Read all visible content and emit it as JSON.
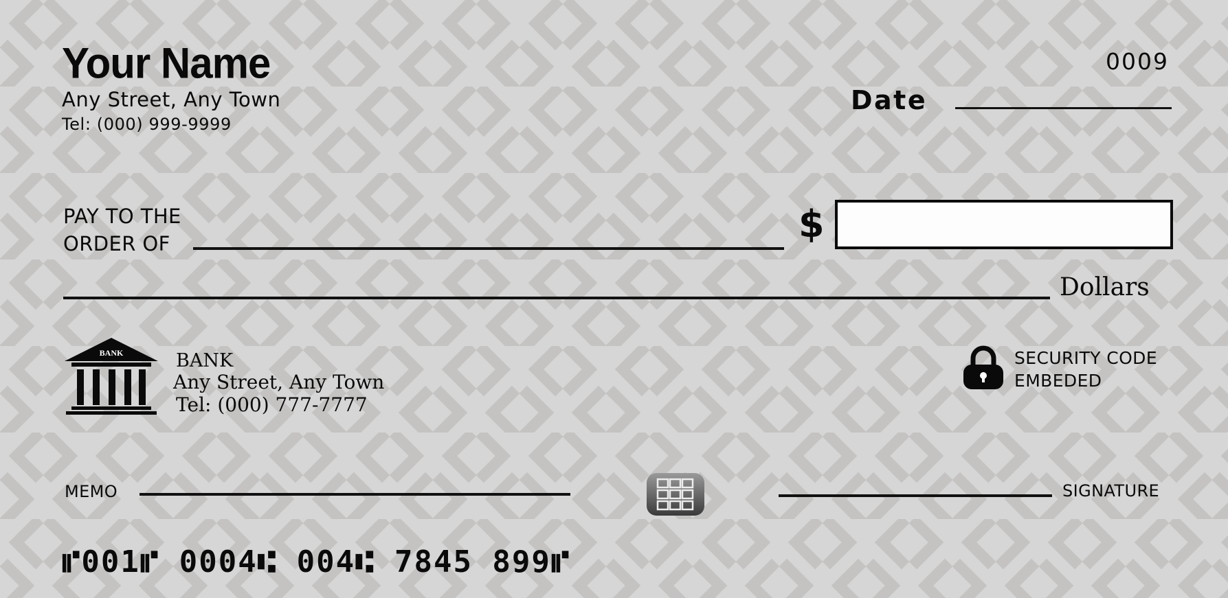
{
  "owner": {
    "name": "Your Name",
    "street": "Any Street, Any Town",
    "tel": "Tel: (000) 999-9999"
  },
  "check_number": "0009",
  "date_label": "Date",
  "pay_to": {
    "line1": "PAY TO THE",
    "line2": "ORDER OF"
  },
  "currency_symbol": "$",
  "dollars_label": "Dollars",
  "bank": {
    "icon_label": "BANK",
    "name": "BANK",
    "street": "Any Street, Any Town",
    "tel": "Tel: (000) 777-7777"
  },
  "security": {
    "line1": "SECURITY CODE",
    "line2": "EMBEDED"
  },
  "memo_label": "MEMO",
  "signature_label": "SIGNATURE",
  "micr_line": "⑈001⑈ 0004⑆ 004⑆ 7845 899⑈",
  "colors": {
    "background": "#d6d6d6",
    "pattern": "#c4c3c1",
    "ink": "#0a0a0a",
    "amount_box_fill": "#fdfdfd"
  },
  "icons": {
    "bank": "bank-building-icon",
    "lock": "padlock-icon",
    "chip": "security-chip-icon"
  }
}
